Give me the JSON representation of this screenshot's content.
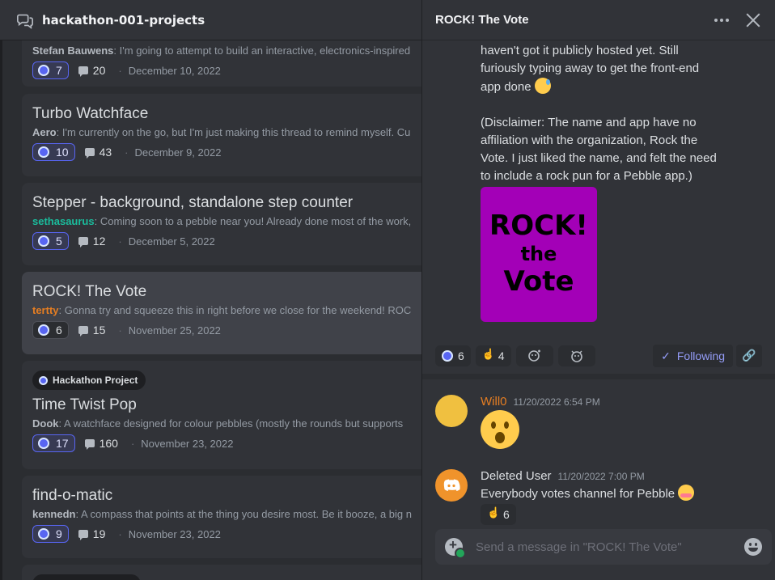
{
  "forum": {
    "title": "hackathon-001-projects",
    "posts": [
      {
        "title": "",
        "author": "Stefan Bauwens",
        "author_color": "#b5bac1",
        "snippet": "I'm going to attempt to build an interactive, electronics-inspired",
        "reactions": "7",
        "messages": "20",
        "date": "December 10, 2022"
      },
      {
        "title": "Turbo Watchface",
        "author": "Aero",
        "author_color": "#b5bac1",
        "snippet": "I'm currently on the go, but I'm just making this thread to remind myself. Cu",
        "reactions": "10",
        "messages": "43",
        "date": "December 9, 2022"
      },
      {
        "title": "Stepper - background, standalone step counter",
        "author": "sethasaurus",
        "author_color": "#1abc9c",
        "snippet": "Coming soon to a pebble near you! Already done most of the work,",
        "reactions": "5",
        "messages": "12",
        "date": "December 5, 2022"
      },
      {
        "title": "ROCK! The Vote",
        "author": "tertty",
        "author_color": "#e67e22",
        "snippet": "Gonna try and squeeze this in right before we close for the weekend! ROC",
        "reactions": "6",
        "messages": "15",
        "date": "November 25, 2022"
      },
      {
        "tag": "Hackathon Project",
        "title": "Time Twist Pop",
        "author": "Dook",
        "author_color": "#b5bac1",
        "snippet": "A watchface designed for colour pebbles (mostly the rounds but supports",
        "reactions": "17",
        "messages": "160",
        "date": "November 23, 2022"
      },
      {
        "title": "find-o-matic",
        "author": "kennedn",
        "author_color": "#b5bac1",
        "snippet": "A compass that points at the thing you desire most. Be it booze, a big n",
        "reactions": "9",
        "messages": "19",
        "date": "November 23, 2022"
      }
    ]
  },
  "thread": {
    "title": "ROCK! The Vote",
    "body_p1": "Currently the back-end is working, but I\nhaven't got it publicly hosted yet. Still\nfuriously typing away to get the front-end\napp done",
    "body_p2": "(Disclaimer: The name and app have no\naffiliation with the organization, Rock the\nVote. I just liked the name, and felt the need\nto include a rock pun for a Pebble app.)",
    "image_lines": [
      "ROCK!",
      "the",
      "Vote"
    ],
    "reactions": [
      {
        "icon": "pebble-emoji",
        "count": "6"
      },
      {
        "icon": "rock-on-emoji",
        "count": "4"
      }
    ],
    "follow_label": "Following",
    "messages": [
      {
        "author": "Will0",
        "author_color": "#e67e22",
        "timestamp": "11/20/2022 6:54 PM",
        "content": ""
      },
      {
        "author": "Deleted User",
        "author_color": "#dbdee1",
        "timestamp": "11/20/2022 7:00 PM",
        "content": "Everybody votes channel for Pebble",
        "reaction_count": "6"
      }
    ],
    "composer_placeholder": "Send a message in \"ROCK! The Vote\""
  },
  "colors": {
    "accent": "#5865f2",
    "image_bg": "#a300b7",
    "background": "#313338"
  }
}
